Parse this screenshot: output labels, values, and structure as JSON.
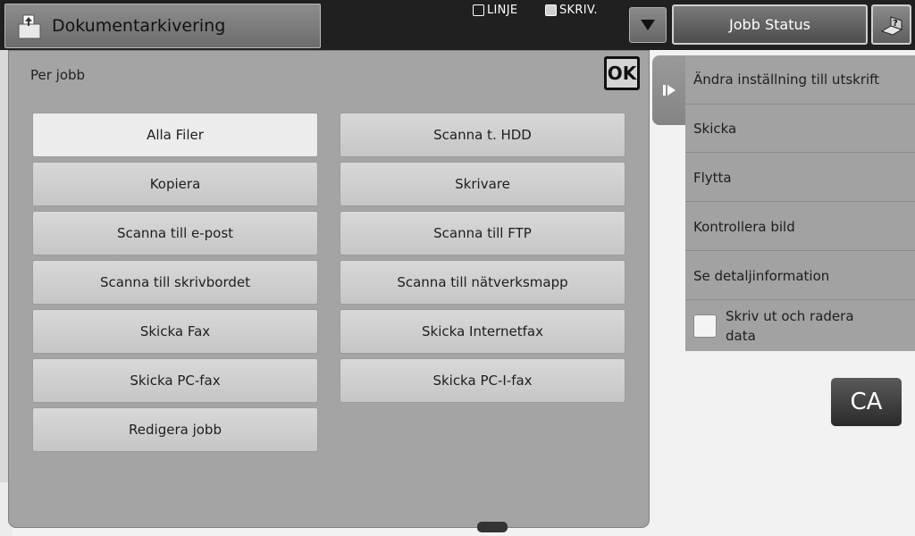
{
  "header": {
    "mode_title": "Dokumentarkivering",
    "mode_icon": "document-filing-icon",
    "indicator_line": "LINJE",
    "indicator_print": "SKRIV.",
    "job_status_label": "Jobb Status",
    "help_icon": "help-icon",
    "dropdown_icon": "triangle-down-icon"
  },
  "dialog": {
    "title": "Per jobb",
    "ok_label": "OK",
    "buttons": [
      "Alla Filer",
      "Scanna t. HDD",
      "Kopiera",
      "Skrivare",
      "Scanna till e-post",
      "Scanna till FTP",
      "Scanna till skrivbordet",
      "Scanna till nätverksmapp",
      "Skicka Fax",
      "Skicka Internetfax",
      "Skicka PC-fax",
      "Skicka PC-I-fax",
      "Redigera jobb"
    ],
    "selected": "Alla Filer"
  },
  "side_panel": {
    "actions": [
      "Ändra inställning till utskrift",
      "Skicka",
      "Flytta",
      "Kontrollera bild",
      "Se detaljinformation"
    ],
    "checkbox_label": "Skriv ut och radera data",
    "checkbox_checked": false
  },
  "ca_label": "CA"
}
